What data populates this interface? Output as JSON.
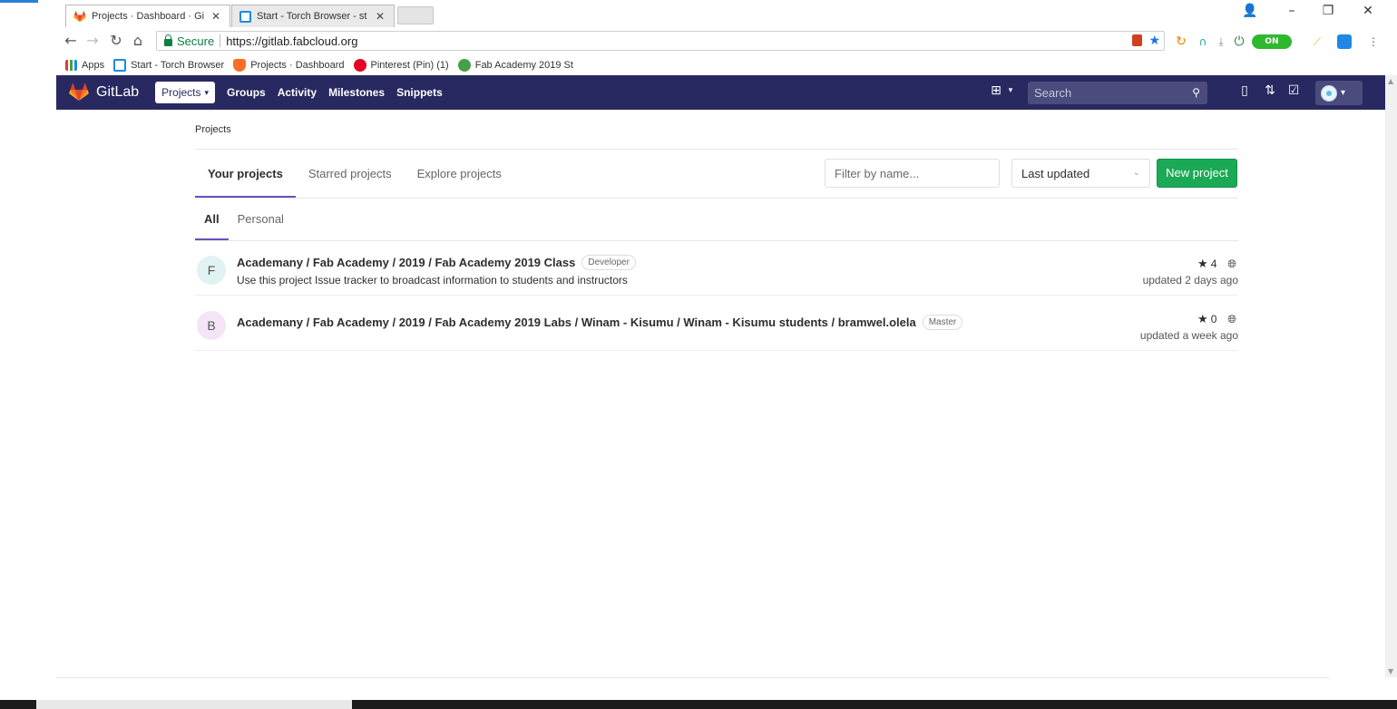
{
  "browser": {
    "tabs": [
      {
        "title": "Projects · Dashboard · Gi",
        "active": true
      },
      {
        "title": "Start - Torch Browser - st",
        "active": false
      }
    ],
    "url": "https://gitlab.fabcloud.org",
    "secure_label": "Secure",
    "bookmarks": [
      {
        "label": "Apps"
      },
      {
        "label": "Start - Torch Browser"
      },
      {
        "label": "Projects · Dashboard"
      },
      {
        "label": "Pinterest (Pin) (1)"
      },
      {
        "label": "Fab Academy 2019 St"
      }
    ],
    "extension_on_label": "ON"
  },
  "gitlab": {
    "brand": "GitLab",
    "nav": {
      "projects": "Projects",
      "groups": "Groups",
      "activity": "Activity",
      "milestones": "Milestones",
      "snippets": "Snippets"
    },
    "search_placeholder": "Search"
  },
  "page": {
    "breadcrumb": "Projects",
    "tabs": {
      "your_projects": "Your projects",
      "starred": "Starred projects",
      "explore": "Explore projects"
    },
    "filter_placeholder": "Filter by name...",
    "sort_value": "Last updated",
    "new_project_label": "New project",
    "subtabs": {
      "all": "All",
      "personal": "Personal"
    },
    "projects": [
      {
        "avatar_letter": "F",
        "avatar_color": "#e0f2f1",
        "name": "Academany / Fab Academy / 2019 / Fab Academy 2019 Class",
        "role": "Developer",
        "description": "Use this project Issue tracker to broadcast information to students and instructors",
        "stars": "4",
        "updated": "updated 2 days ago"
      },
      {
        "avatar_letter": "B",
        "avatar_color": "#f3e5f5",
        "name": "Academany / Fab Academy / 2019 / Fab Academy 2019 Labs / Winam - Kisumu / Winam - Kisumu students / bramwel.olela",
        "role": "Master",
        "description": "",
        "stars": "0",
        "updated": "updated a week ago"
      }
    ]
  },
  "colors": {
    "header_bg": "#292961",
    "new_project_green": "#1aaa55",
    "active_tab_underline": "#6b4fbb",
    "secure_green": "#0b8043"
  }
}
